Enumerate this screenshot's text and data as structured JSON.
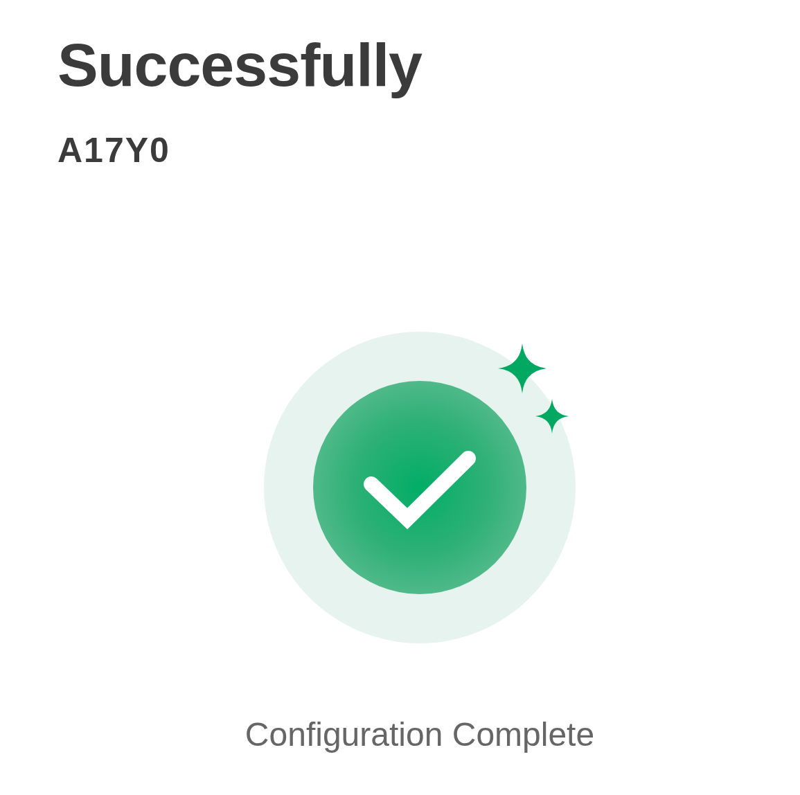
{
  "title": "Successfully",
  "device_id": "A17Y0",
  "status": "Configuration Complete"
}
